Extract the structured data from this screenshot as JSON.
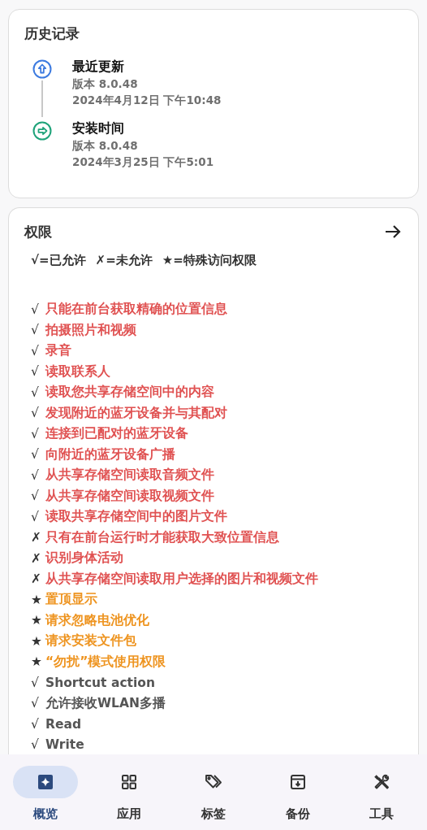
{
  "history": {
    "title": "历史记录",
    "events": [
      {
        "kind": "update",
        "title": "最近更新",
        "version": "版本 8.0.48",
        "time": "2024年4月12日 下午10:48"
      },
      {
        "kind": "install",
        "title": "安装时间",
        "version": "版本 8.0.48",
        "time": "2024年3月25日 下午5:01"
      }
    ]
  },
  "permissions": {
    "title": "权限",
    "legend": [
      {
        "mark": "√",
        "text": "=已允许"
      },
      {
        "mark": "✗",
        "text": "=未允许"
      },
      {
        "mark": "★",
        "text": "=特殊访问权限"
      }
    ],
    "items": [
      {
        "mark": "√",
        "kind": "dangerous",
        "label": "只能在前台获取精确的位置信息"
      },
      {
        "mark": "√",
        "kind": "dangerous",
        "label": "拍摄照片和视频"
      },
      {
        "mark": "√",
        "kind": "dangerous",
        "label": "录音"
      },
      {
        "mark": "√",
        "kind": "dangerous",
        "label": "读取联系人"
      },
      {
        "mark": "√",
        "kind": "dangerous",
        "label": "读取您共享存储空间中的内容"
      },
      {
        "mark": "√",
        "kind": "dangerous",
        "label": "发现附近的蓝牙设备并与其配对"
      },
      {
        "mark": "√",
        "kind": "dangerous",
        "label": "连接到已配对的蓝牙设备"
      },
      {
        "mark": "√",
        "kind": "dangerous",
        "label": "向附近的蓝牙设备广播"
      },
      {
        "mark": "√",
        "kind": "dangerous",
        "label": "从共享存储空间读取音频文件"
      },
      {
        "mark": "√",
        "kind": "dangerous",
        "label": "从共享存储空间读取视频文件"
      },
      {
        "mark": "√",
        "kind": "dangerous",
        "label": "读取共享存储空间中的图片文件"
      },
      {
        "mark": "✗",
        "kind": "dangerous",
        "label": "只有在前台运行时才能获取大致位置信息"
      },
      {
        "mark": "✗",
        "kind": "dangerous",
        "label": "识别身体活动"
      },
      {
        "mark": "✗",
        "kind": "dangerous",
        "label": "从共享存储空间读取用户选择的图片和视频文件"
      },
      {
        "mark": "★",
        "kind": "special",
        "label": "置顶显示"
      },
      {
        "mark": "★",
        "kind": "special",
        "label": "请求忽略电池优化"
      },
      {
        "mark": "★",
        "kind": "special",
        "label": "请求安装文件包"
      },
      {
        "mark": "★",
        "kind": "special",
        "label": "“勿扰”模式使用权限"
      },
      {
        "mark": "√",
        "kind": "normal",
        "label": "Shortcut action"
      },
      {
        "mark": "√",
        "kind": "normal",
        "label": "允许接收WLAN多播"
      },
      {
        "mark": "√",
        "kind": "normal",
        "label": "Read"
      },
      {
        "mark": "√",
        "kind": "normal",
        "label": "Write"
      }
    ]
  },
  "nav": [
    {
      "kind": "overview",
      "label": "概览",
      "selected": true
    },
    {
      "kind": "apps",
      "label": "应用",
      "selected": false
    },
    {
      "kind": "tags",
      "label": "标签",
      "selected": false
    },
    {
      "kind": "backup",
      "label": "备份",
      "selected": false
    },
    {
      "kind": "tools",
      "label": "工具",
      "selected": false
    }
  ]
}
